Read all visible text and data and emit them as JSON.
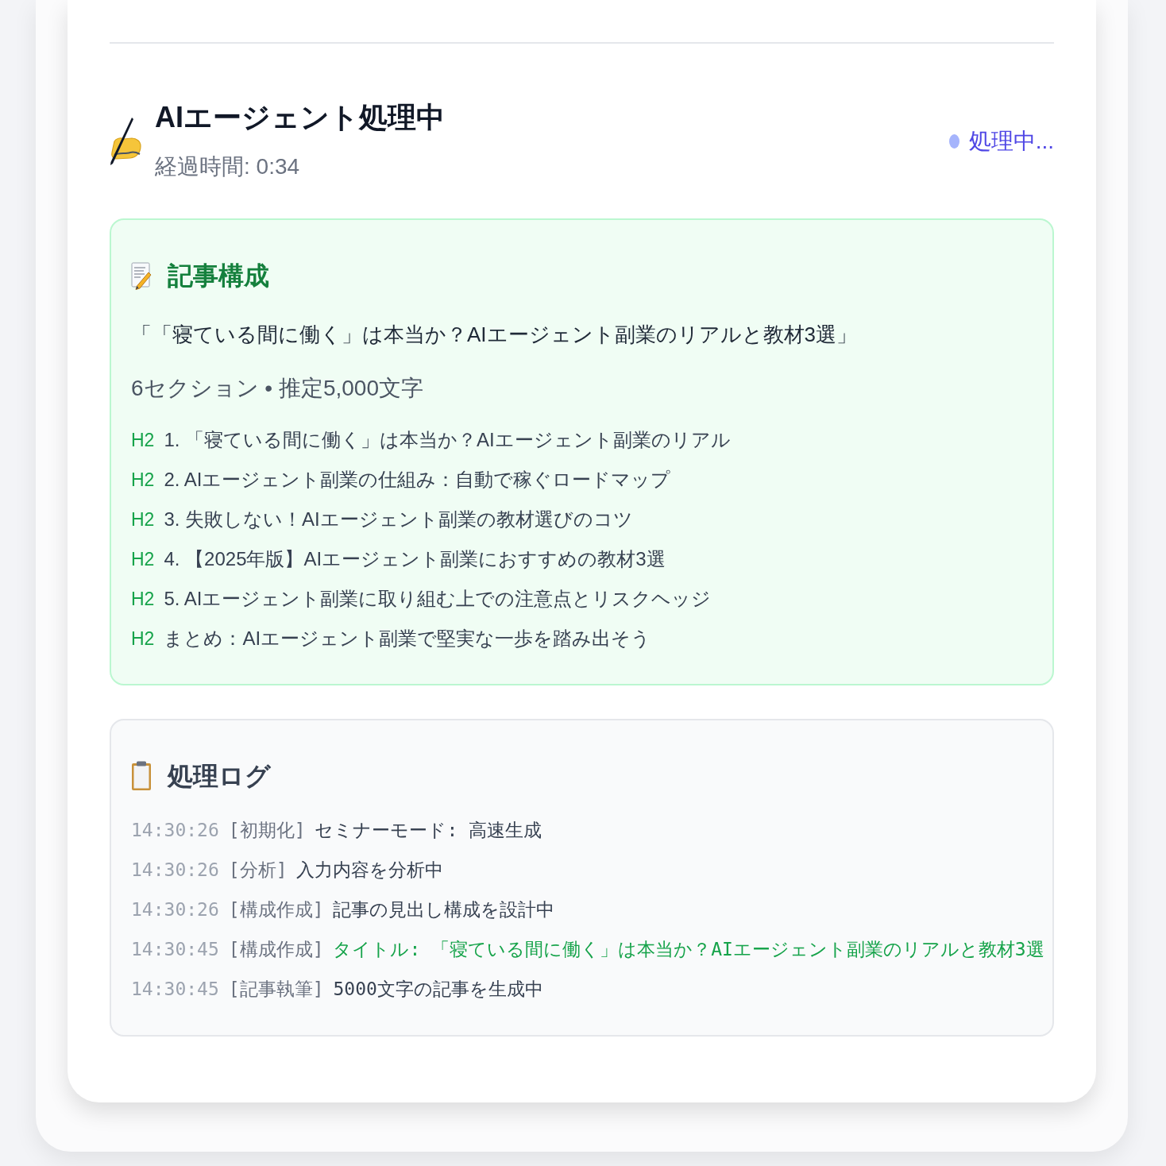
{
  "header": {
    "title": "AIエージェント処理中",
    "elapsed": "経過時間: 0:34",
    "status": {
      "label": "処理中..."
    }
  },
  "outline": {
    "heading": "記事構成",
    "title": "「「寝ている間に働く」は本当か？AIエージェント副業のリアルと教材3選」",
    "summary": "6セクション • 推定5,000文字",
    "sections": [
      {
        "level": "H2",
        "text": "1. 「寝ている間に働く」は本当か？AIエージェント副業のリアル"
      },
      {
        "level": "H2",
        "text": "2. AIエージェント副業の仕組み：自動で稼ぐロードマップ"
      },
      {
        "level": "H2",
        "text": "3. 失敗しない！AIエージェント副業の教材選びのコツ"
      },
      {
        "level": "H2",
        "text": "4. 【2025年版】AIエージェント副業におすすめの教材3選"
      },
      {
        "level": "H2",
        "text": "5. AIエージェント副業に取り組む上での注意点とリスクヘッジ"
      },
      {
        "level": "H2",
        "text": "まとめ：AIエージェント副業で堅実な一歩を踏み出そう"
      }
    ]
  },
  "log": {
    "heading": "処理ログ",
    "entries": [
      {
        "time": "14:30:26",
        "tag": "[初期化]",
        "message": "セミナーモード: 高速生成",
        "kind": "step"
      },
      {
        "time": "14:30:26",
        "tag": "[分析]",
        "message": "入力内容を分析中",
        "kind": "step"
      },
      {
        "time": "14:30:26",
        "tag": "[構成作成]",
        "message": "記事の見出し構成を設計中",
        "kind": "step"
      },
      {
        "time": "14:30:45",
        "tag": "[構成作成]",
        "message": "タイトル: 「寝ている間に働く」は本当か？AIエージェント副業のリアルと教材3選",
        "kind": "result"
      },
      {
        "time": "14:30:45",
        "tag": "[記事執筆]",
        "message": "5000文字の記事を生成中",
        "kind": "step"
      }
    ]
  }
}
